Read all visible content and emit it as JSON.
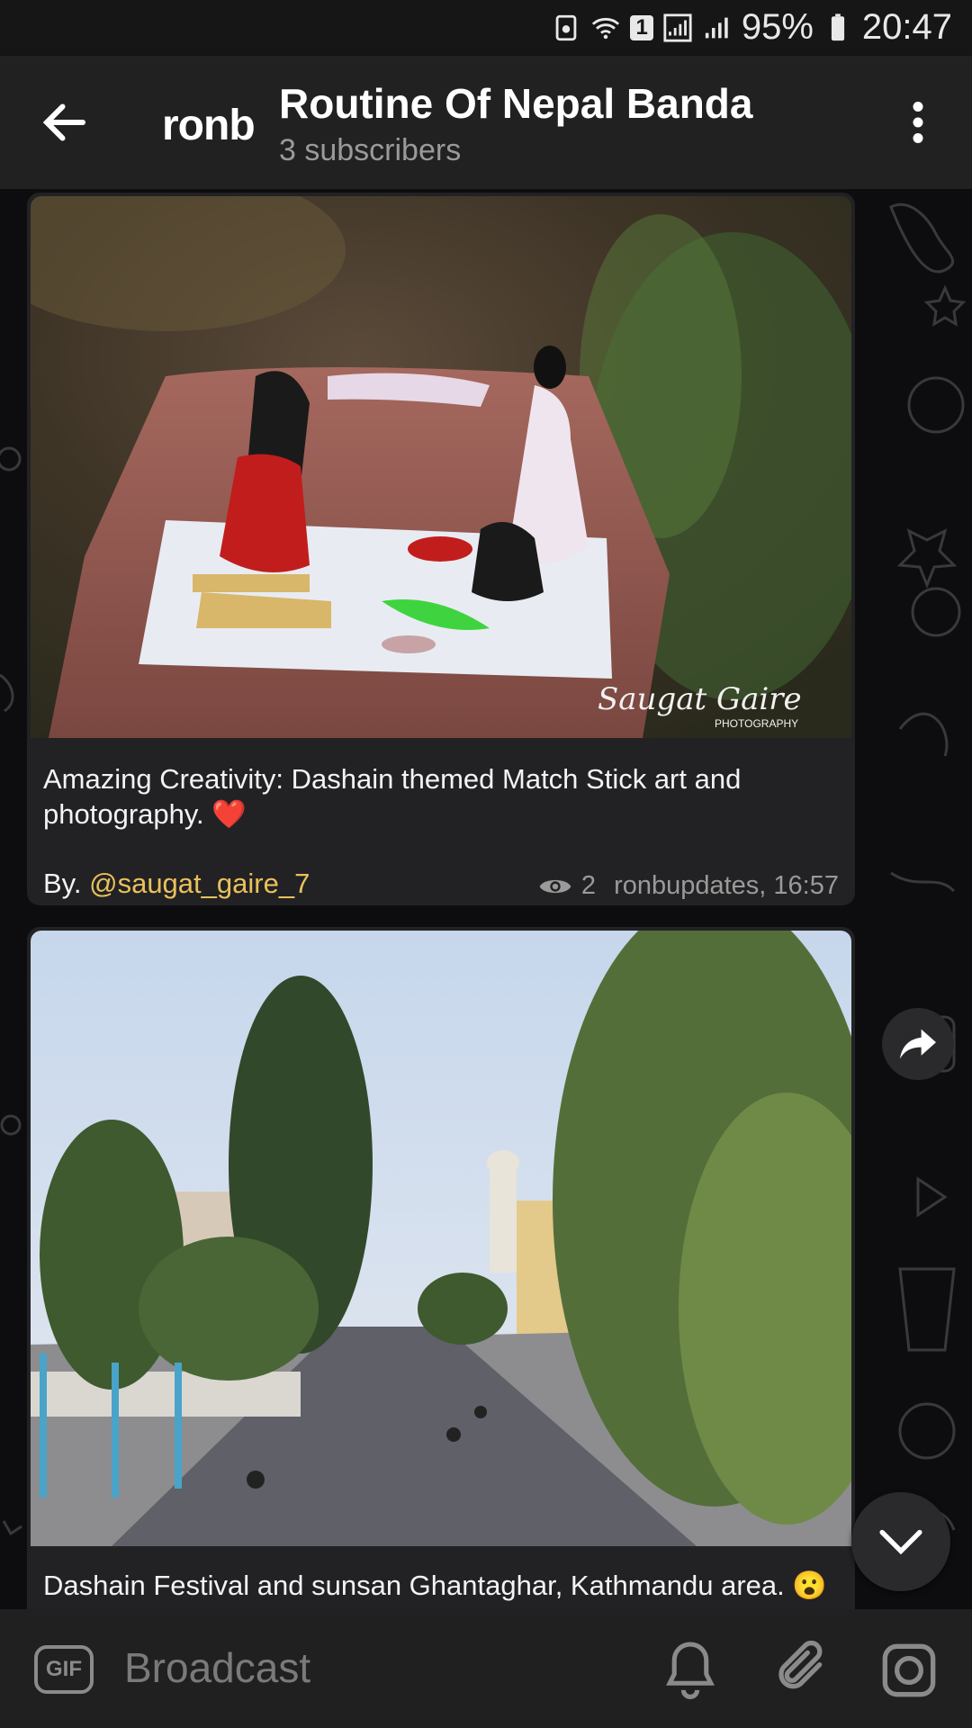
{
  "status_bar": {
    "battery": "95%",
    "time": "20:47",
    "sim_badge": "1"
  },
  "header": {
    "logo": "ronb",
    "title": "Routine Of Nepal Banda",
    "subtitle": "3 subscribers"
  },
  "messages": [
    {
      "photo_watermark": "Saugat Gaire",
      "photo_watermark_sub": "PHOTOGRAPHY",
      "caption": "Amazing Creativity: Dashain themed Match Stick art and photography. ❤️",
      "by_prefix": "By. ",
      "mention": "@saugat_gaire_7",
      "views": "2",
      "author_time": "ronbupdates, 16:57"
    },
    {
      "caption": "Dashain Festival and sunsan Ghantaghar, Kathmandu area. 😮"
    }
  ],
  "composer": {
    "gif_label": "GIF",
    "placeholder": "Broadcast"
  },
  "colors": {
    "header_bg": "#212121",
    "bubble_bg": "#222224",
    "mention": "#e9c15c",
    "muted": "#9a9a9a"
  }
}
